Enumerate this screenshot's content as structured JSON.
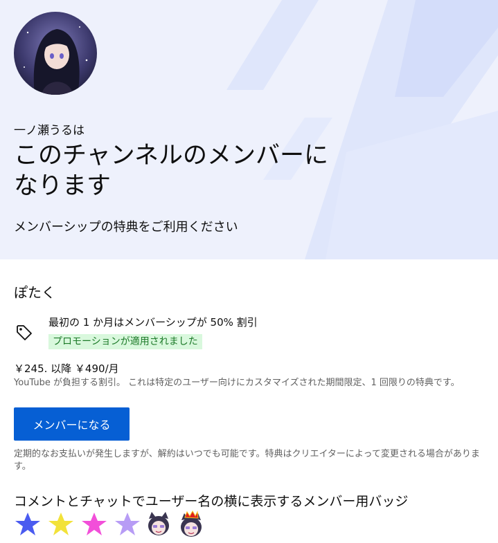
{
  "header": {
    "channel_name": "一ノ瀬うるは",
    "title": "このチャンネルのメンバーになります",
    "subtitle": "メンバーシップの特典をご利用ください"
  },
  "tier": {
    "name": "ぽたく",
    "promo_text": "最初の 1 か月はメンバーシップが 50% 割引",
    "promo_badge": "プロモーションが適用されました",
    "price": "￥245. 以降 ￥490/月",
    "disclaimer": "YouTube が負担する割引。 これは特定のユーザー向けにカスタマイズされた期間限定、1 回限りの特典です。",
    "join_label": "メンバーになる",
    "note": "定期的なお支払いが発生しますが、解約はいつでも可能です。特典はクリエイターによって変更される場合があります。"
  },
  "badges": {
    "title": "コメントとチャットでユーザー名の横に表示するメンバー用バッジ",
    "items": [
      {
        "icon": "blue-star-icon",
        "color": "#4a5bf0"
      },
      {
        "icon": "yellow-star-icon",
        "color": "#f2e23a"
      },
      {
        "icon": "pink-star-icon",
        "color": "#f24fd9"
      },
      {
        "icon": "lavender-star-icon",
        "color": "#b79cf5"
      },
      {
        "icon": "cat-girl-badge-icon",
        "color": "#3a3550"
      },
      {
        "icon": "crowned-cat-girl-badge-icon",
        "color": "#3a3550"
      }
    ]
  },
  "colors": {
    "hero_bg": "#eef1fc",
    "accent": "#065fd4",
    "promo_bg": "#d9f8dd",
    "promo_text": "#1c7a28"
  }
}
